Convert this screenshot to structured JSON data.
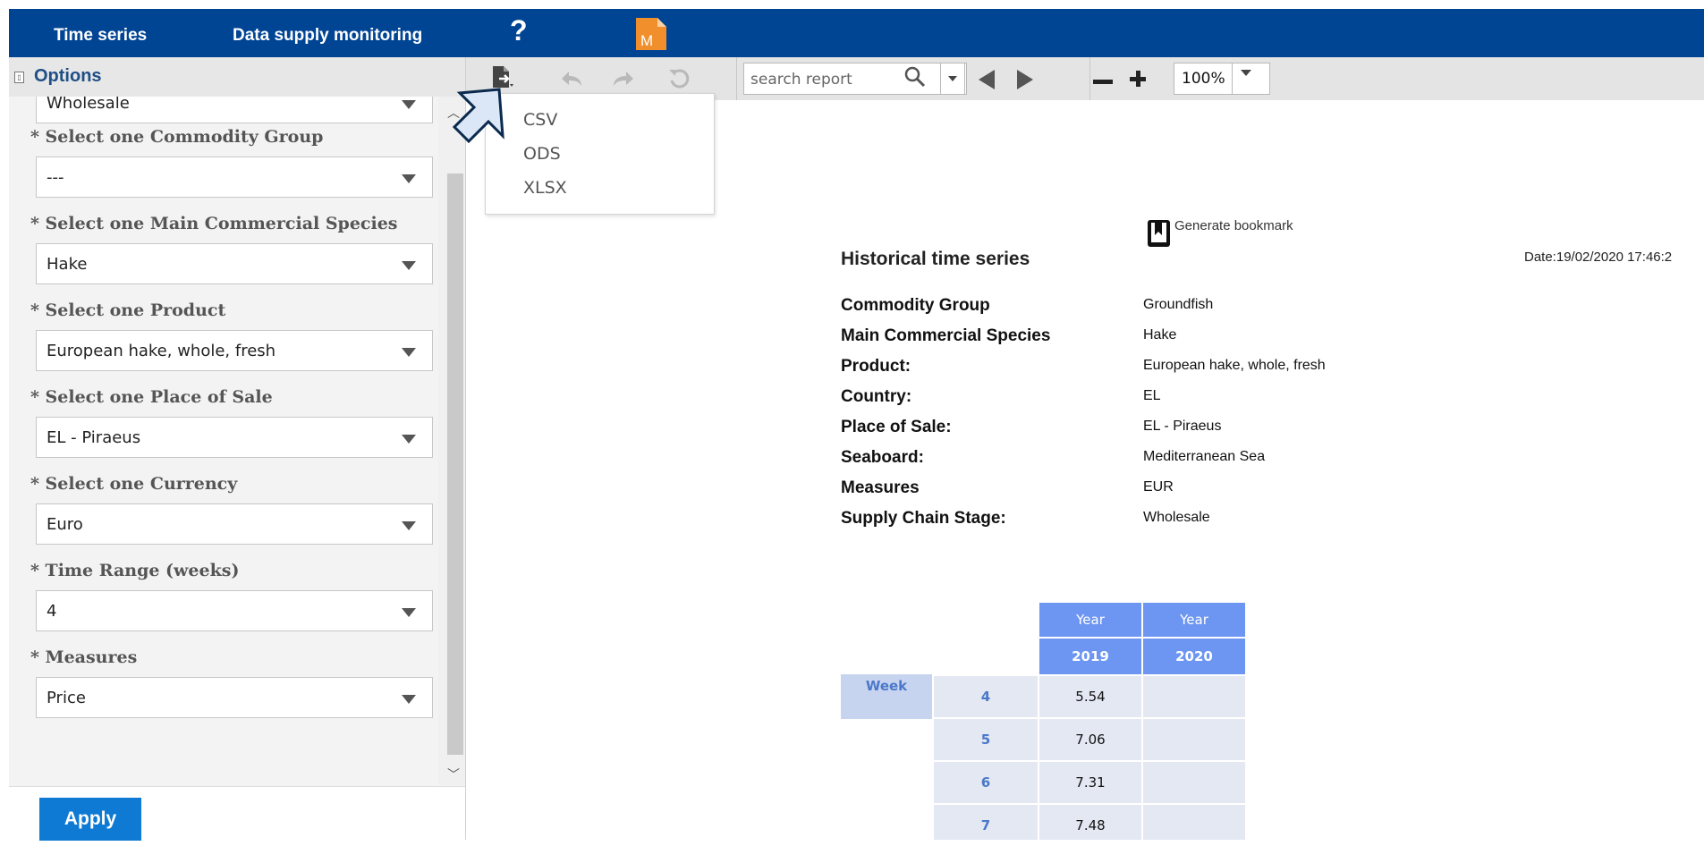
{
  "nav": {
    "links": [
      "Time series",
      "Data supply monitoring"
    ],
    "help_symbol": "?",
    "m_badge": "M",
    "m_badge_color": "#f08f2c"
  },
  "options": {
    "title": "Options",
    "top_value": "Wholesale",
    "fields": [
      {
        "label": "* Select one Commodity Group",
        "value": "---"
      },
      {
        "label": "* Select one Main Commercial Species",
        "value": "Hake"
      },
      {
        "label": "* Select one Product",
        "value": "European hake, whole, fresh"
      },
      {
        "label": "* Select one Place of Sale",
        "value": "EL - Piraeus"
      },
      {
        "label": "* Select one Currency",
        "value": "Euro"
      },
      {
        "label": "* Time Range (weeks)",
        "value": "4"
      },
      {
        "label": "* Measures",
        "value": "Price"
      }
    ],
    "apply_label": "Apply"
  },
  "toolbar": {
    "search_placeholder": "search report",
    "zoom": "100%",
    "icons": [
      "export-icon",
      "undo-icon",
      "redo-icon",
      "refresh-icon",
      "search-icon",
      "prev-page-icon",
      "next-page-icon",
      "zoom-out-icon",
      "zoom-in-icon"
    ]
  },
  "export_menu": [
    "CSV",
    "ODS",
    "XLSX"
  ],
  "report": {
    "bookmark_label": "Generate bookmark",
    "title": "Historical time series",
    "date": "Date:19/02/2020 17:46:2",
    "meta": [
      {
        "label": "Commodity Group",
        "value": "Groundfish"
      },
      {
        "label": "Main Commercial Species",
        "value": "Hake"
      },
      {
        "label": "Product:",
        "value": "European hake, whole, fresh"
      },
      {
        "label": "Country:",
        "value": "EL"
      },
      {
        "label": "Place of Sale:",
        "value": "EL - Piraeus"
      },
      {
        "label": "Seaboard:",
        "value": "Mediterranean Sea"
      },
      {
        "label": "Measures",
        "value": "EUR"
      },
      {
        "label": "Supply Chain Stage:",
        "value": "Wholesale"
      }
    ],
    "table": {
      "col_group": [
        "Year",
        "Year"
      ],
      "col_years": [
        "2019",
        "2020"
      ],
      "row_header": "Week",
      "rows": [
        {
          "week": "4",
          "v2019": "5.54",
          "v2020": ""
        },
        {
          "week": "5",
          "v2019": "7.06",
          "v2020": ""
        },
        {
          "week": "6",
          "v2019": "7.31",
          "v2020": ""
        },
        {
          "week": "7",
          "v2019": "7.48",
          "v2020": ""
        }
      ]
    }
  },
  "colors": {
    "nav_bg": "#004494",
    "accent_blue": "#0e7ad3",
    "table_header": "#6d96f2"
  }
}
